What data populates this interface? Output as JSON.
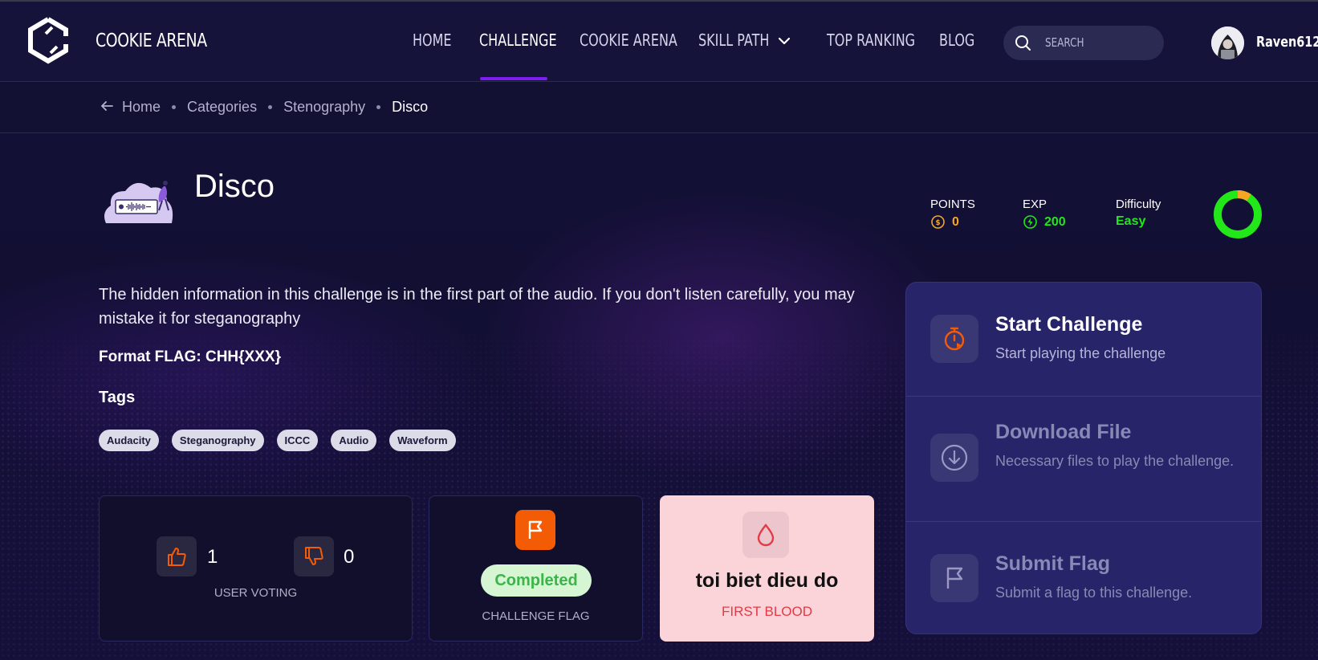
{
  "brand": {
    "name": "COOKIE ARENA"
  },
  "nav": {
    "items": [
      {
        "label": "HOME"
      },
      {
        "label": "CHALLENGE"
      },
      {
        "label": "COOKIE ARENA"
      },
      {
        "label": "SKILL PATH"
      },
      {
        "label": "TOP RANKING"
      },
      {
        "label": "BLOG"
      }
    ],
    "active": "CHALLENGE"
  },
  "search": {
    "placeholder": "SEARCH"
  },
  "user": {
    "name": "Raven612"
  },
  "breadcrumb": [
    "Home",
    "Categories",
    "Stenography",
    "Disco"
  ],
  "challenge": {
    "title": "Disco",
    "description": "The hidden information in this challenge is in the first part of the audio. If you don't listen carefully, you may mistake it for steganography",
    "format_flag": "Format FLAG: CHH{XXX}",
    "tags_heading": "Tags",
    "tags": [
      "Audacity",
      "Steganography",
      "ICCC",
      "Audio",
      "Waveform"
    ]
  },
  "stats": {
    "points": {
      "label": "POINTS",
      "value": "0"
    },
    "exp": {
      "label": "EXP",
      "value": "200"
    },
    "difficulty": {
      "label": "Difficulty",
      "value": "Easy"
    }
  },
  "colors": {
    "accent": "#7c1ef2",
    "easy": "#22e81a",
    "points": "#f5a623",
    "flag_orange": "#f35b04",
    "first_blood": "#e53945"
  },
  "voting": {
    "likes": "1",
    "dislikes": "0",
    "caption": "USER VOTING"
  },
  "flag_card": {
    "status": "Completed",
    "caption": "CHALLENGE FLAG"
  },
  "first_blood": {
    "name": "toi biet dieu do",
    "label": "FIRST BLOOD"
  },
  "actions": [
    {
      "title": "Start Challenge",
      "desc": "Start playing the challenge",
      "icon": "stopwatch-icon",
      "enabled": true
    },
    {
      "title": "Download File",
      "desc": "Necessary files to play the challenge.",
      "icon": "download-icon",
      "enabled": false
    },
    {
      "title": "Submit Flag",
      "desc": "Submit a flag to this challenge.",
      "icon": "flag-icon",
      "enabled": false
    }
  ]
}
